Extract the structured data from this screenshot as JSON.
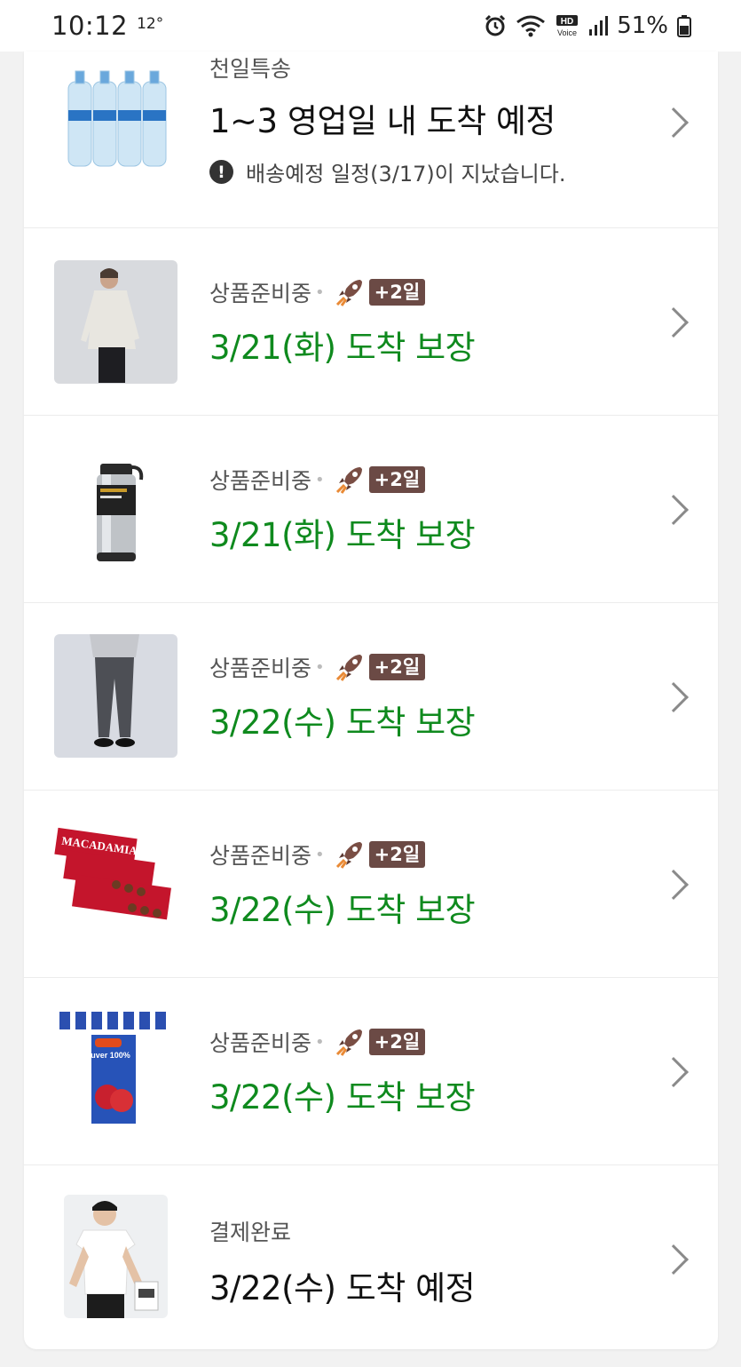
{
  "status_bar": {
    "time": "10:12",
    "temperature": "12°",
    "battery": "51%"
  },
  "orders": [
    {
      "status": "천일특송",
      "arrival": "1~3 영업일 내 도착 예정",
      "warning": "배송예정 일정(3/17)이 지났습니다.",
      "image": "water-bottles",
      "arrival_color": "#111111"
    },
    {
      "status": "상품준비중",
      "badge": "+2일",
      "arrival": "3/21(화) 도착 보장",
      "image": "shirt-model",
      "arrival_color": "#0f8a1e"
    },
    {
      "status": "상품준비중",
      "badge": "+2일",
      "arrival": "3/21(화) 도착 보장",
      "image": "thermos",
      "arrival_color": "#0f8a1e"
    },
    {
      "status": "상품준비중",
      "badge": "+2일",
      "arrival": "3/22(수) 도착 보장",
      "image": "pants-model",
      "arrival_color": "#0f8a1e"
    },
    {
      "status": "상품준비중",
      "badge": "+2일",
      "arrival": "3/22(수) 도착 보장",
      "image": "macadamia-chocolate",
      "image_text": "MACADAMIA",
      "arrival_color": "#0f8a1e"
    },
    {
      "status": "상품준비중",
      "badge": "+2일",
      "arrival": "3/22(수) 도착 보장",
      "image": "apple-juice-cartons",
      "image_text": "Juver 100%",
      "arrival_color": "#0f8a1e"
    },
    {
      "status": "결제완료",
      "arrival": "3/22(수) 도착 예정",
      "image": "tshirt-model",
      "arrival_color": "#111111"
    }
  ]
}
